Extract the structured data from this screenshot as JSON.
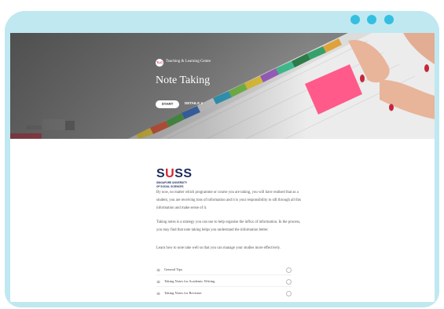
{
  "window_controls": [
    "dot-1",
    "dot-2",
    "dot-3"
  ],
  "colors": {
    "frame": "#bfe8f1",
    "dots": "#34bfe0",
    "suss_navy": "#1d2b5e",
    "suss_red": "#d8232a"
  },
  "hero": {
    "logo_text": "TLC",
    "org_name": "Teaching & Learning Centre",
    "title": "Note Taking",
    "start_label": "START",
    "details_label": "DETAILS ∨"
  },
  "brand": {
    "logo_prefix": "S",
    "logo_accent": "U",
    "logo_suffix": "SS",
    "subtitle_line1": "SINGAPORE UNIVERSITY",
    "subtitle_line2": "OF SOCIAL SCIENCES"
  },
  "content": {
    "para1": "By now, no matter which programme or course you are taking, you will have realised that as a student, you are receiving tons of information and it is your responsibility to sift through all this information and make sense of it.",
    "para2": "Taking notes is a strategy you can use to help organise the influx of information. In the process, you may find that note taking helps you understand the information better.",
    "para3": "Learn how to note take well so that you can manage your studies more effectively."
  },
  "lessons": [
    {
      "label": "General Tips",
      "icon": "lesson-lines-icon"
    },
    {
      "label": "Taking Notes for Academic Writing",
      "icon": "lesson-lines-icon"
    },
    {
      "label": "Taking Notes for Revision",
      "icon": "lesson-lines-icon"
    }
  ]
}
